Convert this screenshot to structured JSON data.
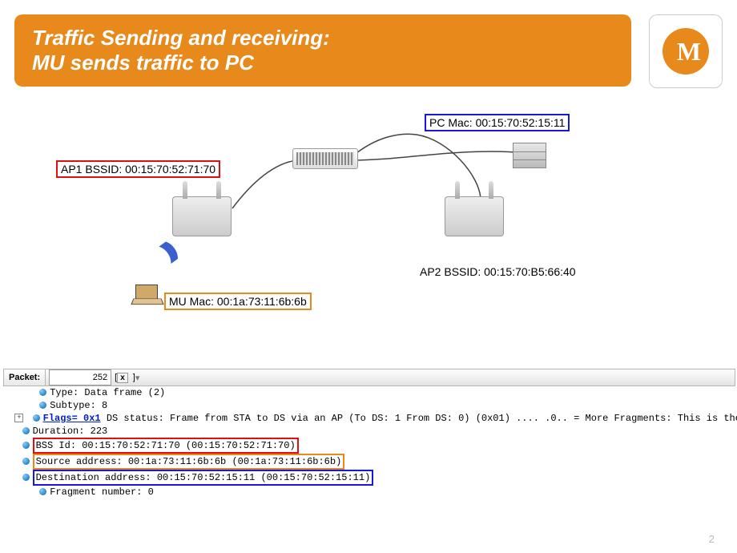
{
  "title_line1": "Traffic Sending and receiving:",
  "title_line2": "MU sends traffic to PC",
  "labels": {
    "ap1": "AP1 BSSID: 00:15:70:52:71:70",
    "ap2": "AP2 BSSID: 00:15:70:B5:66:40",
    "pc": "PC Mac: 00:15:70:52:15:11",
    "mu": "MU Mac: 00:1a:73:11:6b:6b"
  },
  "packet_bar": {
    "label": "Packet:",
    "value": "252",
    "close": "x"
  },
  "tree": {
    "type": "Type: Data frame (2)",
    "subtype": "Subtype: 8",
    "flags_label": "Flags= 0x1",
    "flags_rest": " DS status: Frame from STA to DS via an AP (To DS: 1 From DS: 0) (0x01) .... .0.. = More Fragments: This is the",
    "duration": "Duration: 223",
    "bss": "BSS Id: 00:15:70:52:71:70 (00:15:70:52:71:70)",
    "src": "Source address: 00:1a:73:11:6b:6b (00:1a:73:11:6b:6b)",
    "dst": "Destination address: 00:15:70:52:15:11 (00:15:70:52:15:11)",
    "frag": "Fragment number: 0"
  },
  "page_number": "2"
}
